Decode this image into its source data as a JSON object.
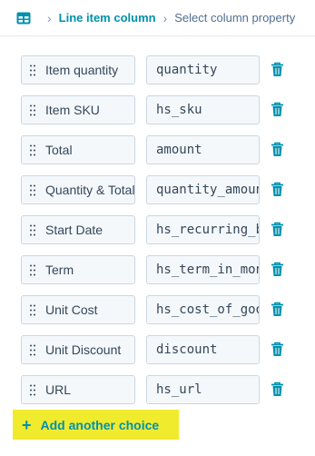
{
  "breadcrumb": {
    "icon": "table-icon",
    "parent": "Line item column",
    "current": "Select column property"
  },
  "rows": [
    {
      "label": "",
      "value": ""
    },
    {
      "label": "Item quantity",
      "value": "quantity"
    },
    {
      "label": "Item SKU",
      "value": "hs_sku"
    },
    {
      "label": "Total",
      "value": "amount"
    },
    {
      "label": "Quantity & Total",
      "value": "quantity_amount"
    },
    {
      "label": "Start Date",
      "value": "hs_recurring_billing_start_date"
    },
    {
      "label": "Term",
      "value": "hs_term_in_months"
    },
    {
      "label": "Unit Cost",
      "value": "hs_cost_of_goods_sold"
    },
    {
      "label": "Unit Discount",
      "value": "discount"
    },
    {
      "label": "URL",
      "value": "hs_url"
    }
  ],
  "add_button": {
    "label": "Add another choice",
    "icon": "plus-icon"
  },
  "colors": {
    "accent": "#0091ae",
    "highlight": "#f0eb2d",
    "field_bg": "#f5f8fa",
    "border": "#cbd6e2"
  }
}
